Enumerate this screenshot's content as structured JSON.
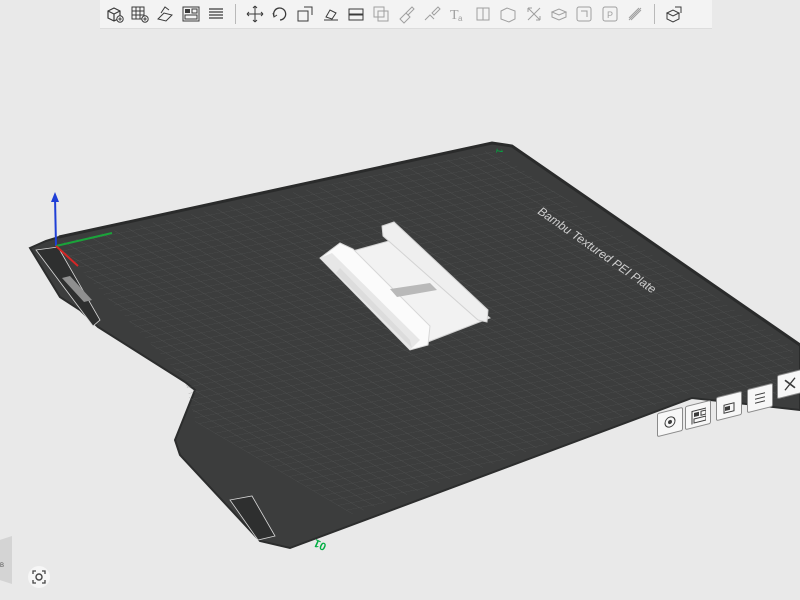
{
  "toolbar": {
    "groups": [
      [
        "add-object-icon",
        "add-plate-icon",
        "orient-icon",
        "arrange-icon",
        "layers-list-icon"
      ],
      [
        "move-icon",
        "rotate-icon",
        "scale-icon",
        "lay-on-face-icon",
        "cut-icon",
        "mesh-boolean-icon",
        "support-paint-icon",
        "seam-paint-icon",
        "text-icon",
        "variable-layer-icon",
        "assembly-icon",
        "measure-icon",
        "split-icon",
        "split-objects-icon",
        "split-parts-icon",
        "slice-plane-icon"
      ],
      [
        "assembly-view-icon"
      ]
    ]
  },
  "plate": {
    "label": "Bambu Textured PEI Plate",
    "corner_mark_top": "1",
    "corner_mark_bottom": "01",
    "plate_color": "#3c3d3d",
    "grid_color": "#5c5e5e",
    "edge_color": "#2e2f2f",
    "accent_color": "#00ae42"
  },
  "plate_tools": [
    "auto-orient-icon",
    "arrange-icon",
    "lock-icon",
    "plate-settings-icon",
    "close-icon"
  ],
  "view_cube_label": "B"
}
